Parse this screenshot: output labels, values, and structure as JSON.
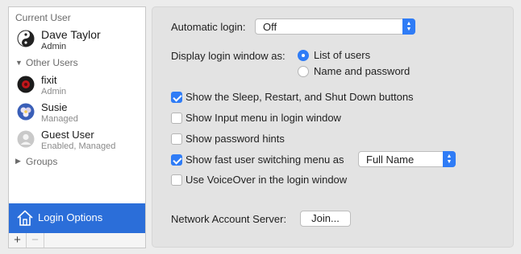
{
  "sidebar": {
    "current_user_header": "Current User",
    "current_user": {
      "name": "Dave Taylor",
      "role": "Admin",
      "icon": "yin-yang-icon"
    },
    "other_users_header": "Other Users",
    "other_users": [
      {
        "name": "fixit",
        "role": "Admin",
        "icon": "avatar-red-icon"
      },
      {
        "name": "Susie",
        "role": "Managed",
        "icon": "avatar-flower-icon"
      },
      {
        "name": "Guest User",
        "role": "Enabled, Managed",
        "icon": "guest-avatar-icon"
      }
    ],
    "groups_header": "Groups",
    "login_options_label": "Login Options",
    "add_symbol": "+",
    "remove_symbol": "−"
  },
  "panel": {
    "automatic_login_label": "Automatic login:",
    "automatic_login_value": "Off",
    "display_login_label": "Display login window as:",
    "display_options": [
      {
        "label": "List of users",
        "selected": true
      },
      {
        "label": "Name and password",
        "selected": false
      }
    ],
    "checkboxes": [
      {
        "label": "Show the Sleep, Restart, and Shut Down buttons",
        "checked": true
      },
      {
        "label": "Show Input menu in login window",
        "checked": false
      },
      {
        "label": "Show password hints",
        "checked": false
      },
      {
        "label": "Show fast user switching menu as",
        "checked": true
      },
      {
        "label": "Use VoiceOver in the login window",
        "checked": false
      }
    ],
    "fast_switch_value": "Full Name",
    "network_server_label": "Network Account Server:",
    "join_button_label": "Join..."
  },
  "colors": {
    "accent": "#2f7cf6",
    "selection": "#2b6ed9"
  }
}
